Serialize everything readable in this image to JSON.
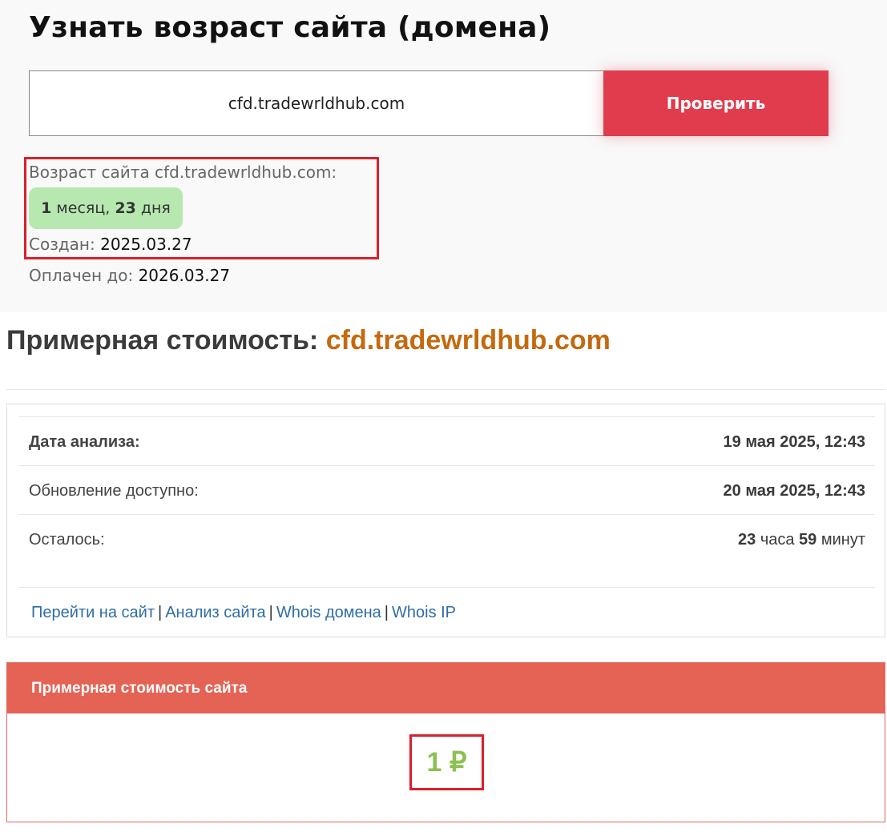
{
  "header": {
    "title": "Узнать возраст сайта (домена)"
  },
  "search": {
    "value": "cfd.tradewrldhub.com",
    "button_label": "Проверить"
  },
  "result": {
    "age_label": "Возраст сайта cfd.tradewrldhub.com:",
    "age_months": "1",
    "age_months_unit": "месяц,",
    "age_days": "23",
    "age_days_unit": "дня",
    "created_label": "Создан:",
    "created_value": "2025.03.27",
    "paid_label": "Оплачен до:",
    "paid_value": "2026.03.27"
  },
  "valuation": {
    "title_prefix": "Примерная стоимость:",
    "title_domain": "cfd.tradewrldhub.com",
    "rows": [
      {
        "key": "Дата анализа:",
        "value": "19 мая 2025, 12:43"
      },
      {
        "key": "Обновление доступно:",
        "value": "20 мая 2025, 12:43"
      },
      {
        "key": "Осталось:",
        "hours": "23",
        "hours_unit": "часа",
        "minutes": "59",
        "minutes_unit": "минут"
      }
    ],
    "links": [
      "Перейти на сайт",
      "Анализ сайта",
      "Whois домена",
      "Whois IP"
    ],
    "link_separator": "|",
    "cost_header": "Примерная стоимость сайта",
    "cost_value": "1 ₽"
  },
  "colors": {
    "button": "#e03c4d",
    "highlight_border": "#d8202e",
    "age_badge": "#b6e8b0",
    "domain_accent": "#c46a0e",
    "cost_header": "#e46355",
    "cost_value": "#8cc152",
    "link": "#2f6da4"
  }
}
